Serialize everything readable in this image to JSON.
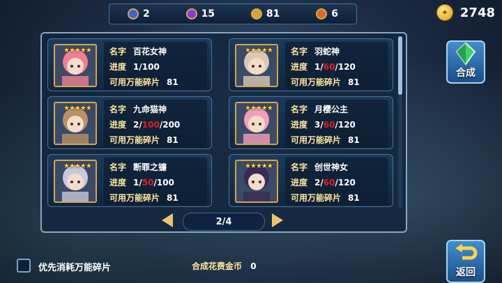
{
  "resources": [
    {
      "icon": "blue-orb-icon",
      "value": "2"
    },
    {
      "icon": "purple-orb-icon",
      "value": "15"
    },
    {
      "icon": "gold-orb-icon",
      "value": "81"
    },
    {
      "icon": "orange-orb-icon",
      "value": "6"
    }
  ],
  "gold": {
    "value": "2748",
    "icon": "gold-coin-icon"
  },
  "labels": {
    "name": "名字",
    "progress": "进度",
    "shards": "可用万能碎片"
  },
  "cards": [
    {
      "stars": "★★★★★",
      "name": "百花女神",
      "prog_have": "1",
      "prog_mid": "",
      "prog_total": "100",
      "shards": "81"
    },
    {
      "stars": "★★★★★",
      "name": "羽蛇神",
      "prog_have": "1",
      "prog_mid": "60",
      "prog_total": "120",
      "shards": "81"
    },
    {
      "stars": "★★★★★",
      "name": "九命猫神",
      "prog_have": "2",
      "prog_mid": "100",
      "prog_total": "200",
      "shards": "81"
    },
    {
      "stars": "★★★★★",
      "name": "月樱公主",
      "prog_have": "3",
      "prog_mid": "60",
      "prog_total": "120",
      "shards": "81"
    },
    {
      "stars": "★★★★★",
      "name": "断罪之镰",
      "prog_have": "1",
      "prog_mid": "50",
      "prog_total": "100",
      "shards": "81"
    },
    {
      "stars": "★★★★★",
      "name": "创世神女",
      "prog_have": "2",
      "prog_mid": "60",
      "prog_total": "120",
      "shards": "81"
    }
  ],
  "pager": {
    "text": "2/4"
  },
  "buttons": {
    "synthesize": "合成",
    "back": "返回"
  },
  "bottom": {
    "checkbox_label": "优先消耗万能碎片",
    "cost_label": "合成花费金币",
    "cost_value": "0"
  },
  "colors": {
    "accent_gold": "#e9c46a",
    "highlight_red": "#e02020",
    "panel_bg": "#12263e"
  }
}
